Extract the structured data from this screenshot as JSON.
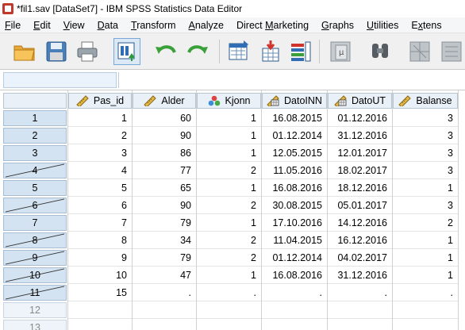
{
  "window": {
    "title": "*fil1.sav [DataSet7] - IBM SPSS Statistics Data Editor"
  },
  "menu": [
    {
      "label": "File",
      "u": "F"
    },
    {
      "label": "Edit",
      "u": "E"
    },
    {
      "label": "View",
      "u": "V"
    },
    {
      "label": "Data",
      "u": "D"
    },
    {
      "label": "Transform",
      "u": "T"
    },
    {
      "label": "Analyze",
      "u": "A"
    },
    {
      "label": "Direct Marketing",
      "u": "M"
    },
    {
      "label": "Graphs",
      "u": "G"
    },
    {
      "label": "Utilities",
      "u": "U"
    },
    {
      "label": "Extens",
      "u": "x"
    }
  ],
  "toolbar": {
    "icons": [
      "open-folder-icon",
      "save-icon",
      "print-icon",
      "recall-dialog-icon",
      "undo-icon",
      "redo-icon",
      "goto-case-icon",
      "goto-variable-icon",
      "variables-icon",
      "descriptives-icon",
      "find-icon",
      "split-file-icon",
      "weight-cases-icon"
    ]
  },
  "cell_editor": {
    "reference": "",
    "value": ""
  },
  "table": {
    "columns": [
      {
        "name": "Pas_id",
        "icon": "scale-ruler-icon"
      },
      {
        "name": "Alder",
        "icon": "scale-ruler-icon"
      },
      {
        "name": "Kjonn",
        "icon": "nominal-balls-icon"
      },
      {
        "name": "DatoINN",
        "icon": "date-scale-icon"
      },
      {
        "name": "DatoUT",
        "icon": "date-scale-icon"
      },
      {
        "name": "Balanse",
        "icon": "scale-ruler-icon"
      }
    ],
    "rows": [
      {
        "n": "1",
        "filtered": false,
        "cells": [
          "1",
          "60",
          "1",
          "16.08.2015",
          "01.12.2016",
          "3"
        ]
      },
      {
        "n": "2",
        "filtered": false,
        "cells": [
          "2",
          "90",
          "1",
          "01.12.2014",
          "31.12.2016",
          "3"
        ]
      },
      {
        "n": "3",
        "filtered": false,
        "cells": [
          "3",
          "86",
          "1",
          "12.05.2015",
          "12.01.2017",
          "3"
        ]
      },
      {
        "n": "4",
        "filtered": true,
        "cells": [
          "4",
          "77",
          "2",
          "11.05.2016",
          "18.02.2017",
          "3"
        ]
      },
      {
        "n": "5",
        "filtered": false,
        "cells": [
          "5",
          "65",
          "1",
          "16.08.2016",
          "18.12.2016",
          "1"
        ]
      },
      {
        "n": "6",
        "filtered": true,
        "cells": [
          "6",
          "90",
          "2",
          "30.08.2015",
          "05.01.2017",
          "3"
        ]
      },
      {
        "n": "7",
        "filtered": false,
        "cells": [
          "7",
          "79",
          "1",
          "17.10.2016",
          "14.12.2016",
          "2"
        ]
      },
      {
        "n": "8",
        "filtered": true,
        "cells": [
          "8",
          "34",
          "2",
          "11.04.2015",
          "16.12.2016",
          "1"
        ]
      },
      {
        "n": "9",
        "filtered": true,
        "cells": [
          "9",
          "79",
          "2",
          "01.12.2014",
          "04.02.2017",
          "1"
        ]
      },
      {
        "n": "10",
        "filtered": true,
        "cells": [
          "10",
          "47",
          "1",
          "16.08.2016",
          "31.12.2016",
          "1"
        ]
      },
      {
        "n": "11",
        "filtered": true,
        "cells": [
          "15",
          ".",
          ".",
          ".",
          ".",
          "."
        ]
      },
      {
        "n": "12",
        "filtered": false,
        "empty": true,
        "cells": [
          "",
          "",
          "",
          "",
          "",
          ""
        ]
      },
      {
        "n": "13",
        "filtered": false,
        "empty": true,
        "cells": [
          "",
          "",
          "",
          "",
          "",
          ""
        ]
      }
    ]
  },
  "colors": {
    "header_bg": "#e9f0f7",
    "row_head_bg": "#d4e3f2",
    "toolbar_bg": "#f0f0f0"
  }
}
